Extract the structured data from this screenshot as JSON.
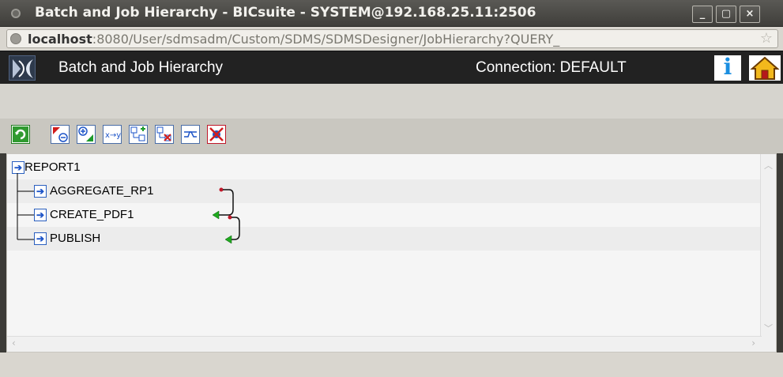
{
  "window": {
    "title": "Batch and Job Hierarchy - BICsuite - SYSTEM@192.168.25.11:2506",
    "buttons": [
      "_",
      "▢",
      "×"
    ]
  },
  "browser": {
    "url_host": "localhost",
    "url_rest": ":8080/User/sdmsadm/Custom/SDMS/SDMSDesigner/JobHierarchy?QUERY_"
  },
  "header": {
    "title": "Batch and Job Hierarchy",
    "connection": "Connection:  DEFAULT",
    "info_glyph": "i"
  },
  "toolbar": {
    "buttons": [
      "refresh",
      "collapse-all",
      "expand-all",
      "xy",
      "add-child",
      "delete-child",
      "toggle",
      "cancel"
    ]
  },
  "tree": {
    "root": "REPORT1",
    "children": [
      "AGGREGATE_RP1",
      "CREATE_PDF1",
      "PUBLISH"
    ],
    "icon_glyph": "➔"
  },
  "colors": {
    "title_bg": "#4a4945",
    "header_bg": "#222222",
    "dependency_red": "#c0182a",
    "dependency_green": "#1faa1f",
    "node_blue": "#1e55c8"
  }
}
